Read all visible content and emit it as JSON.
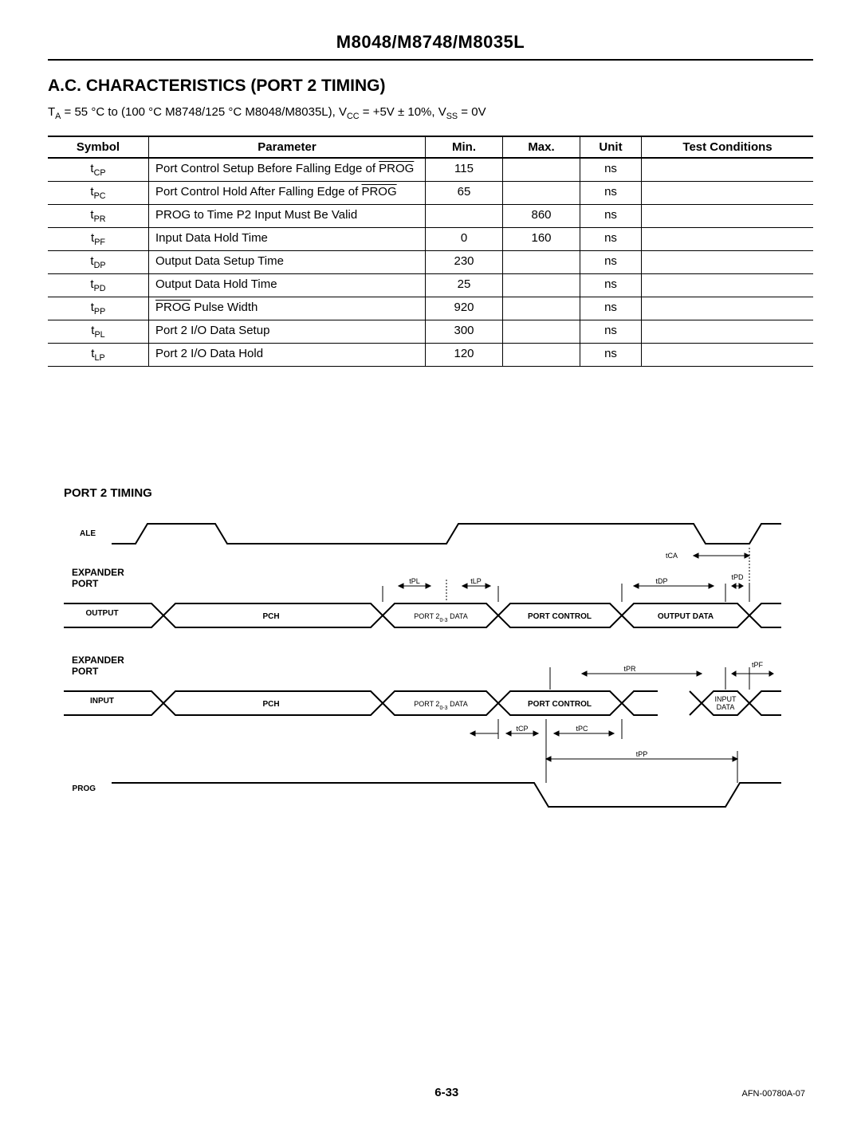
{
  "header": {
    "part_numbers": "M8048/M8748/M8035L"
  },
  "section": {
    "title": "A.C. CHARACTERISTICS (PORT 2 TIMING)",
    "conditions_prefix": "T",
    "conditions_text": " = 55 °C to (100 °C M8748/125 °C M8048/M8035L), V",
    "conditions_mid": " = +5V ± 10%, V",
    "conditions_end": " = 0V"
  },
  "table": {
    "headers": {
      "symbol": "Symbol",
      "parameter": "Parameter",
      "min": "Min.",
      "max": "Max.",
      "unit": "Unit",
      "test": "Test Conditions"
    },
    "rows": [
      {
        "sym_main": "t",
        "sym_sub": "CP",
        "param_pre": "Port Control Setup Before Falling Edge of ",
        "param_over": "PROG",
        "param_post": "",
        "min": "115",
        "max": "",
        "unit": "ns",
        "tc": ""
      },
      {
        "sym_main": "t",
        "sym_sub": "PC",
        "param_pre": "Port Control Hold After Falling Edge of ",
        "param_over": "PROG",
        "param_post": "",
        "min": "65",
        "max": "",
        "unit": "ns",
        "tc": ""
      },
      {
        "sym_main": "t",
        "sym_sub": "PR",
        "param_pre": "PROG to Time P2 Input Must Be Valid",
        "param_over": "",
        "param_post": "",
        "min": "",
        "max": "860",
        "unit": "ns",
        "tc": ""
      },
      {
        "sym_main": "t",
        "sym_sub": "PF",
        "param_pre": "Input Data Hold Time",
        "param_over": "",
        "param_post": "",
        "min": "0",
        "max": "160",
        "unit": "ns",
        "tc": ""
      },
      {
        "sym_main": "t",
        "sym_sub": "DP",
        "param_pre": "Output Data Setup Time",
        "param_over": "",
        "param_post": "",
        "min": "230",
        "max": "",
        "unit": "ns",
        "tc": ""
      },
      {
        "sym_main": "t",
        "sym_sub": "PD",
        "param_pre": "Output Data Hold Time",
        "param_over": "",
        "param_post": "",
        "min": "25",
        "max": "",
        "unit": "ns",
        "tc": ""
      },
      {
        "sym_main": "t",
        "sym_sub": "PP",
        "param_pre": "",
        "param_over": "PROG",
        "param_post": " Pulse Width",
        "min": "920",
        "max": "",
        "unit": "ns",
        "tc": ""
      },
      {
        "sym_main": "t",
        "sym_sub": "PL",
        "param_pre": "Port 2 I/O Data Setup",
        "param_over": "",
        "param_post": "",
        "min": "300",
        "max": "",
        "unit": "ns",
        "tc": ""
      },
      {
        "sym_main": "t",
        "sym_sub": "LP",
        "param_pre": "Port 2 I/O Data Hold",
        "param_over": "",
        "param_post": "",
        "min": "120",
        "max": "",
        "unit": "ns",
        "tc": ""
      }
    ]
  },
  "diagram": {
    "title": "PORT 2 TIMING",
    "labels": {
      "ale": "ALE",
      "expander_port": "EXPANDER PORT",
      "output": "OUTPUT",
      "input": "INPUT",
      "prog": "PROG",
      "pch": "PCH",
      "port20_3": "PORT 2₀₋₃ DATA",
      "port_control": "PORT CONTROL",
      "output_data": "OUTPUT DATA",
      "input_data": "INPUT DATA",
      "tca": "tCA",
      "tpl": "tPL",
      "tlp": "tLP",
      "tdp": "tDP",
      "tpd": "tPD",
      "tpr": "tPR",
      "tpf": "tPF",
      "tcp": "tCP",
      "tpc": "tPC",
      "tpp": "tPP"
    }
  },
  "footer": {
    "page": "6-33",
    "doc": "AFN-00780A-07"
  }
}
